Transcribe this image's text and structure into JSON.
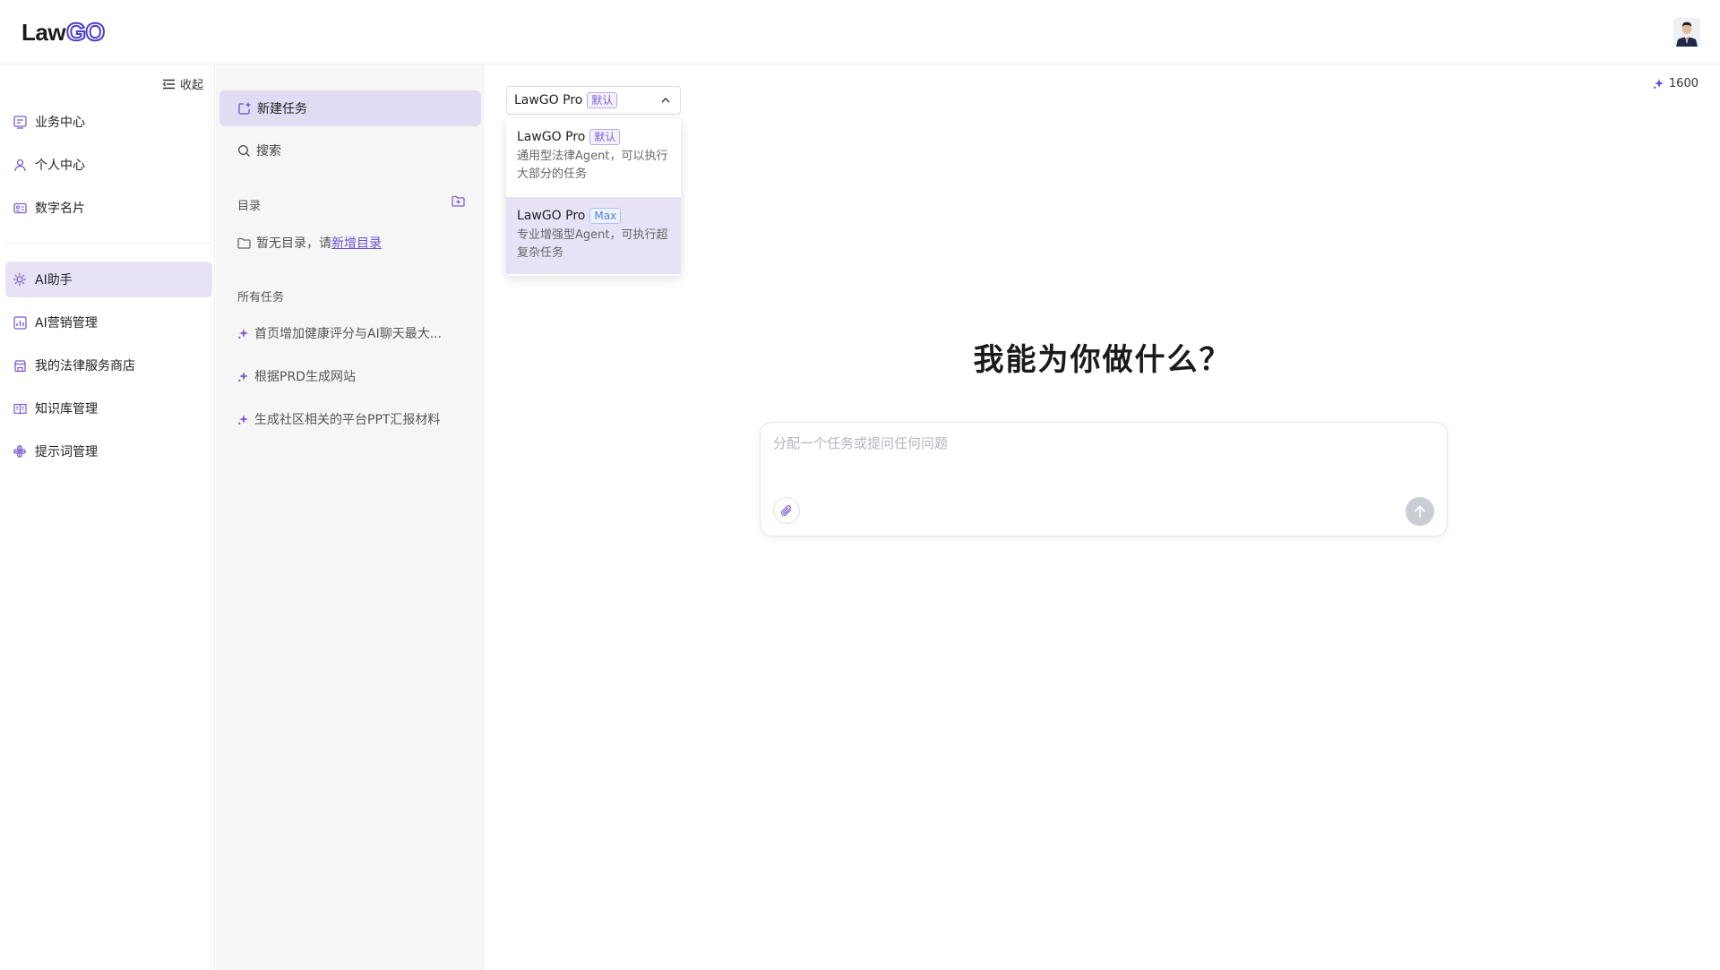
{
  "app": {
    "logo_law": "Law",
    "logo_go": "GO"
  },
  "sidebar": {
    "collapse_label": "收起",
    "items": [
      {
        "label": "业务中心",
        "icon": "dashboard-icon"
      },
      {
        "label": "个人中心",
        "icon": "user-icon"
      },
      {
        "label": "数字名片",
        "icon": "card-icon"
      },
      {
        "label": "AI助手",
        "icon": "ai-assistant-icon",
        "active": true
      },
      {
        "label": "AI营销管理",
        "icon": "chart-icon"
      },
      {
        "label": "我的法律服务商店",
        "icon": "store-icon"
      },
      {
        "label": "知识库管理",
        "icon": "book-icon"
      },
      {
        "label": "提示词管理",
        "icon": "prompt-icon"
      }
    ]
  },
  "panel": {
    "new_task": "新建任务",
    "search": "搜索",
    "directory_label": "目录",
    "empty_dir_text": "暂无目录，请",
    "empty_dir_link": "新增目录",
    "all_tasks_label": "所有任务",
    "tasks": [
      "首页增加健康评分与AI聊天最大...",
      "根据PRD生成网站",
      "生成社区相关的平台PPT汇报材料"
    ]
  },
  "main": {
    "model_select": {
      "name": "LawGO Pro",
      "tag": "默认"
    },
    "options": [
      {
        "name": "LawGO Pro",
        "tag": "默认",
        "desc": "通用型法律Agent，可以执行大部分的任务"
      },
      {
        "name": "LawGO Pro",
        "tag": "Max",
        "desc": "专业增强型Agent，可执行超复杂任务"
      }
    ],
    "credits": "1600",
    "title": "我能为你做什么？",
    "input_placeholder": "分配一个任务或提问任何问题"
  },
  "colors": {
    "accent": "#6a4fc9",
    "active_bg": "#e8e2f7",
    "new_task_bg": "#e2dbf4"
  }
}
